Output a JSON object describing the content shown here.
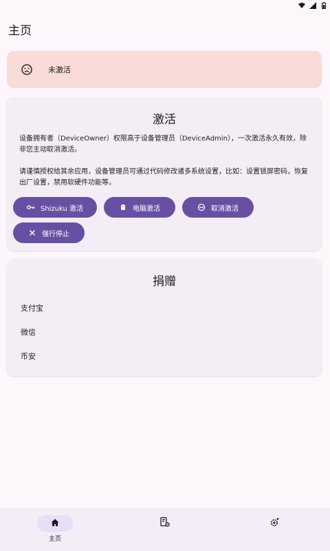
{
  "header": {
    "title": "主页"
  },
  "status": {
    "label": "未激活",
    "color": "#f9dcd7"
  },
  "activate_card": {
    "title": "激活",
    "para1": "设备拥有者（DeviceOwner）权限高于设备管理员（DeviceAdmin），一次激活永久有效，除非您主动取消激活。",
    "para2": "请谨慎授权给其余应用，设备管理员可通过代码修改诸多系统设置，比如：设置锁屏密码，恢复出厂设置，禁用软硬件功能等。",
    "buttons": {
      "shizuku": "Shizuku 激活",
      "pc": "电脑激活",
      "cancel": "取消激活",
      "force_stop": "强行停止"
    }
  },
  "donate_card": {
    "title": "捐赠",
    "items": [
      "支付宝",
      "微信",
      "币安"
    ]
  },
  "bottom_nav": {
    "items": [
      {
        "label": "主页",
        "icon": "home-icon",
        "active": true
      },
      {
        "label": "",
        "icon": "app-settings-icon",
        "active": false
      },
      {
        "label": "",
        "icon": "settings-gear-icon",
        "active": false
      }
    ]
  },
  "colors": {
    "accent": "#6750a4",
    "card_bg": "#f3eef5",
    "page_bg": "#fdf7fc",
    "nav_active": "#e8def8"
  }
}
